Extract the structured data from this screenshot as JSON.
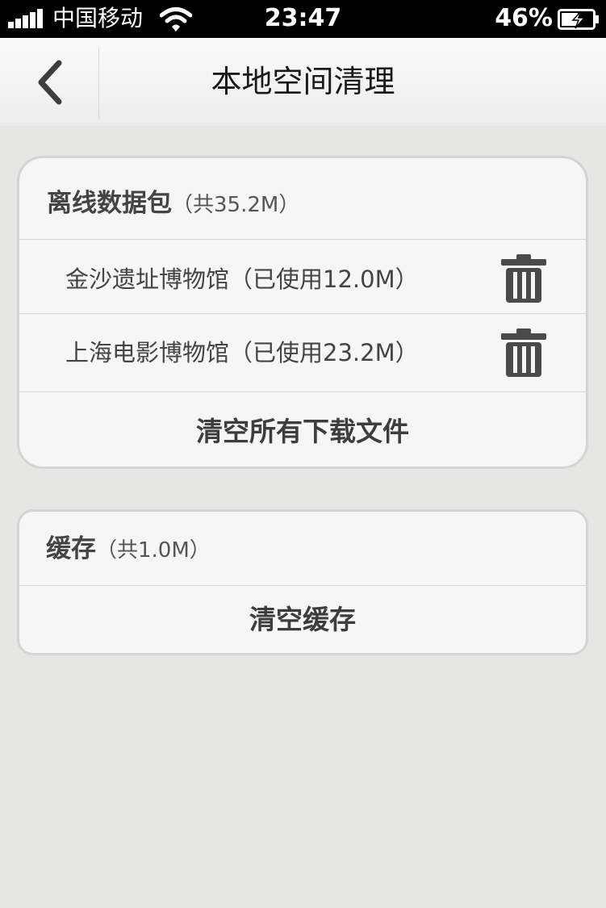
{
  "status_bar": {
    "carrier": "中国移动",
    "time": "23:47",
    "battery": "46%"
  },
  "nav": {
    "title": "本地空间清理",
    "back_icon": "chevron-left-icon"
  },
  "offline_section": {
    "title": "离线数据包",
    "total": "（共35.2M）",
    "items": [
      {
        "label": "金沙遗址博物馆（已使用12.0M）",
        "icon": "trash-icon"
      },
      {
        "label": "上海电影博物馆（已使用23.2M）",
        "icon": "trash-icon"
      }
    ],
    "clear_all_label": "清空所有下载文件"
  },
  "cache_section": {
    "title": "缓存",
    "total": "（共1.0M）",
    "clear_label": "清空缓存"
  },
  "colors": {
    "background": "#e6e6e4",
    "card": "#f6f6f6",
    "icon": "#4a4a4a"
  }
}
